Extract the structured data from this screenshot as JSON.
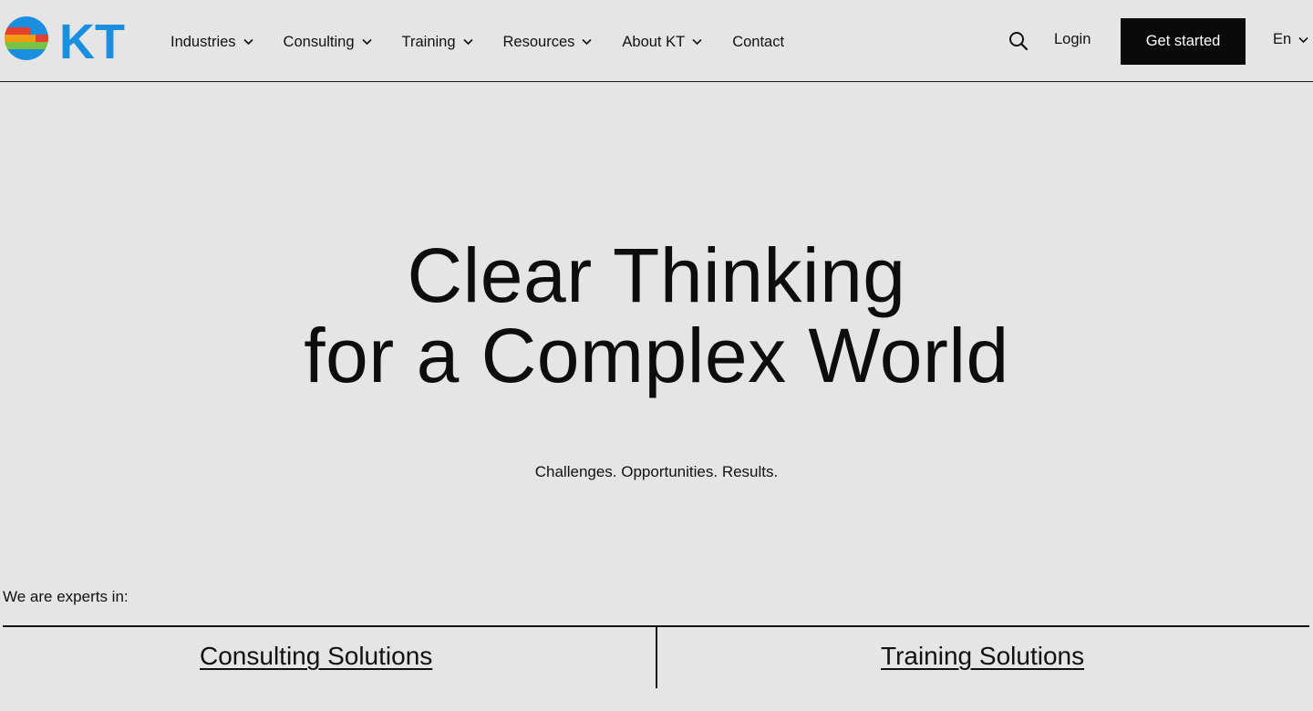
{
  "brand": {
    "name": "KT",
    "colors": {
      "blue": "#1a8fe0",
      "red": "#e8402e",
      "orange": "#f39c12",
      "green": "#7cc242",
      "accent_dark": "#0a0a0a"
    },
    "logo_icon": "kt-globe-logo"
  },
  "nav": {
    "items": [
      {
        "label": "Industries",
        "has_dropdown": true
      },
      {
        "label": "Consulting",
        "has_dropdown": true
      },
      {
        "label": "Training",
        "has_dropdown": true
      },
      {
        "label": "Resources",
        "has_dropdown": true
      },
      {
        "label": "About KT",
        "has_dropdown": true
      },
      {
        "label": "Contact",
        "has_dropdown": false
      }
    ]
  },
  "header_actions": {
    "search_icon": "search-icon",
    "login_label": "Login",
    "cta_label": "Get started",
    "language_label": "En"
  },
  "hero": {
    "title_line1": "Clear Thinking",
    "title_line2": "for a Complex World",
    "subtitle": "Challenges. Opportunities. Results."
  },
  "experts": {
    "label": "We are experts in:",
    "solutions": [
      {
        "label": "Consulting Solutions"
      },
      {
        "label": "Training Solutions"
      }
    ]
  }
}
